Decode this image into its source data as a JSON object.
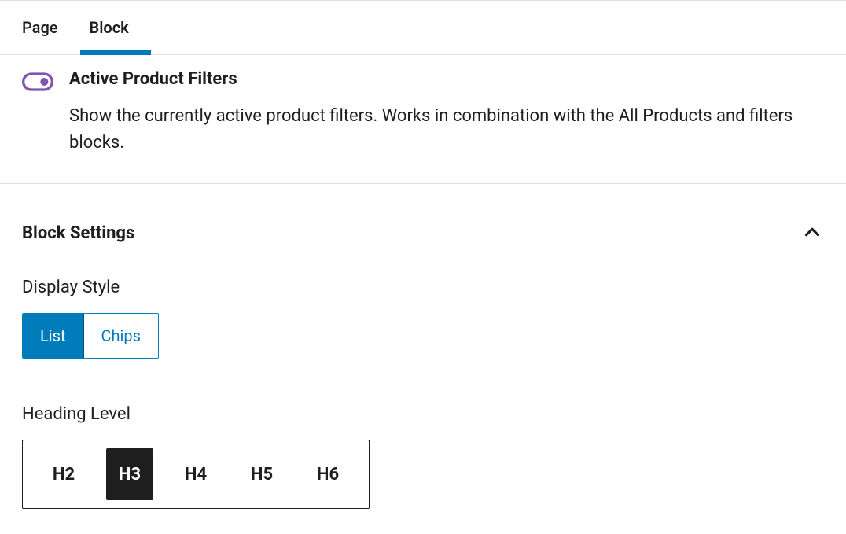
{
  "tabs": {
    "page": "Page",
    "block": "Block"
  },
  "block_info": {
    "title": "Active Product Filters",
    "description": "Show the currently active product filters. Works in combination with the All Products and filters blocks.",
    "icon_name": "toggle-icon",
    "icon_color": "#7f54b3"
  },
  "settings": {
    "header": "Block Settings",
    "display_style": {
      "label": "Display Style",
      "options": {
        "list": "List",
        "chips": "Chips"
      },
      "selected": "list"
    },
    "heading_level": {
      "label": "Heading Level",
      "options": [
        "H2",
        "H3",
        "H4",
        "H5",
        "H6"
      ],
      "selected": "H3"
    }
  }
}
